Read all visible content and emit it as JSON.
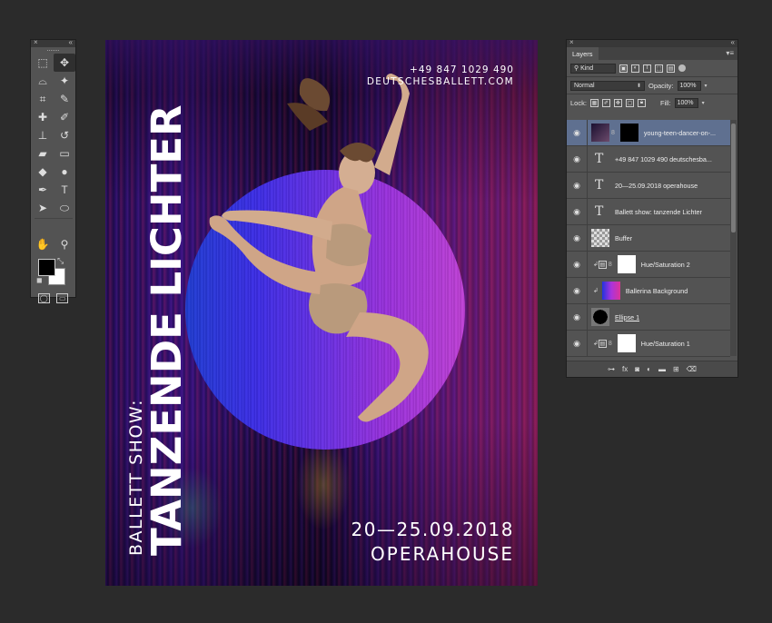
{
  "tools_panel": {
    "close_icon": "×",
    "collapse_icon": "«",
    "tools": [
      {
        "name": "marquee-tool-icon",
        "glyph": "⬚"
      },
      {
        "name": "move-tool-icon",
        "glyph": "✥"
      },
      {
        "name": "lasso-tool-icon",
        "glyph": "⌓"
      },
      {
        "name": "magic-wand-tool-icon",
        "glyph": "✦"
      },
      {
        "name": "crop-tool-icon",
        "glyph": "⌗"
      },
      {
        "name": "eyedropper-tool-icon",
        "glyph": "✎"
      },
      {
        "name": "healing-brush-tool-icon",
        "glyph": "✚"
      },
      {
        "name": "brush-tool-icon",
        "glyph": "✐"
      },
      {
        "name": "clone-stamp-tool-icon",
        "glyph": "⊥"
      },
      {
        "name": "history-brush-tool-icon",
        "glyph": "↺"
      },
      {
        "name": "eraser-tool-icon",
        "glyph": "▰"
      },
      {
        "name": "gradient-tool-icon",
        "glyph": "▭"
      },
      {
        "name": "blur-tool-icon",
        "glyph": "◆"
      },
      {
        "name": "dodge-tool-icon",
        "glyph": "●"
      },
      {
        "name": "pen-tool-icon",
        "glyph": "✒"
      },
      {
        "name": "type-tool-icon",
        "glyph": "T"
      },
      {
        "name": "path-selection-tool-icon",
        "glyph": "➤"
      },
      {
        "name": "ellipse-tool-icon",
        "glyph": "⬭"
      },
      {
        "name": "hand-tool-icon",
        "glyph": "✋"
      },
      {
        "name": "zoom-tool-icon",
        "glyph": "⚲"
      }
    ],
    "colors": {
      "foreground": "#000000",
      "background": "#ffffff"
    }
  },
  "poster": {
    "phone": "+49 847 1029 490",
    "url": "DEUTSCHESBALLETT.COM",
    "subtitle": "BALLETT SHOW:",
    "title": "TANZENDE LICHTER",
    "date": "20—25.09.2018",
    "venue": "OPERAHOUSE"
  },
  "layers_panel": {
    "tab": "Layers",
    "filter_kind": "Kind",
    "blend_mode": "Normal",
    "opacity_label": "Opacity:",
    "opacity_value": "100%",
    "lock_label": "Lock:",
    "fill_label": "Fill:",
    "fill_value": "100%",
    "layers": [
      {
        "name": "young-teen-dancer-on-...",
        "kind": "image-mask",
        "selected": true
      },
      {
        "name": "+49 847 1029 490 deutschesba...",
        "kind": "text"
      },
      {
        "name": "20—25.09.2018 operahouse",
        "kind": "text"
      },
      {
        "name": "Ballett show: tanzende Lichter",
        "kind": "text"
      },
      {
        "name": "Buffer",
        "kind": "smart"
      },
      {
        "name": "Hue/Saturation 2",
        "kind": "adjustment"
      },
      {
        "name": "Ballerina Background",
        "kind": "gradient"
      },
      {
        "name": "Ellipse 1",
        "kind": "shape"
      },
      {
        "name": "Hue/Saturation 1",
        "kind": "adjustment"
      }
    ],
    "footer_icons": [
      "link-icon",
      "fx-icon",
      "mask-icon",
      "adjustment-icon",
      "folder-icon",
      "new-layer-icon",
      "trash-icon"
    ]
  }
}
